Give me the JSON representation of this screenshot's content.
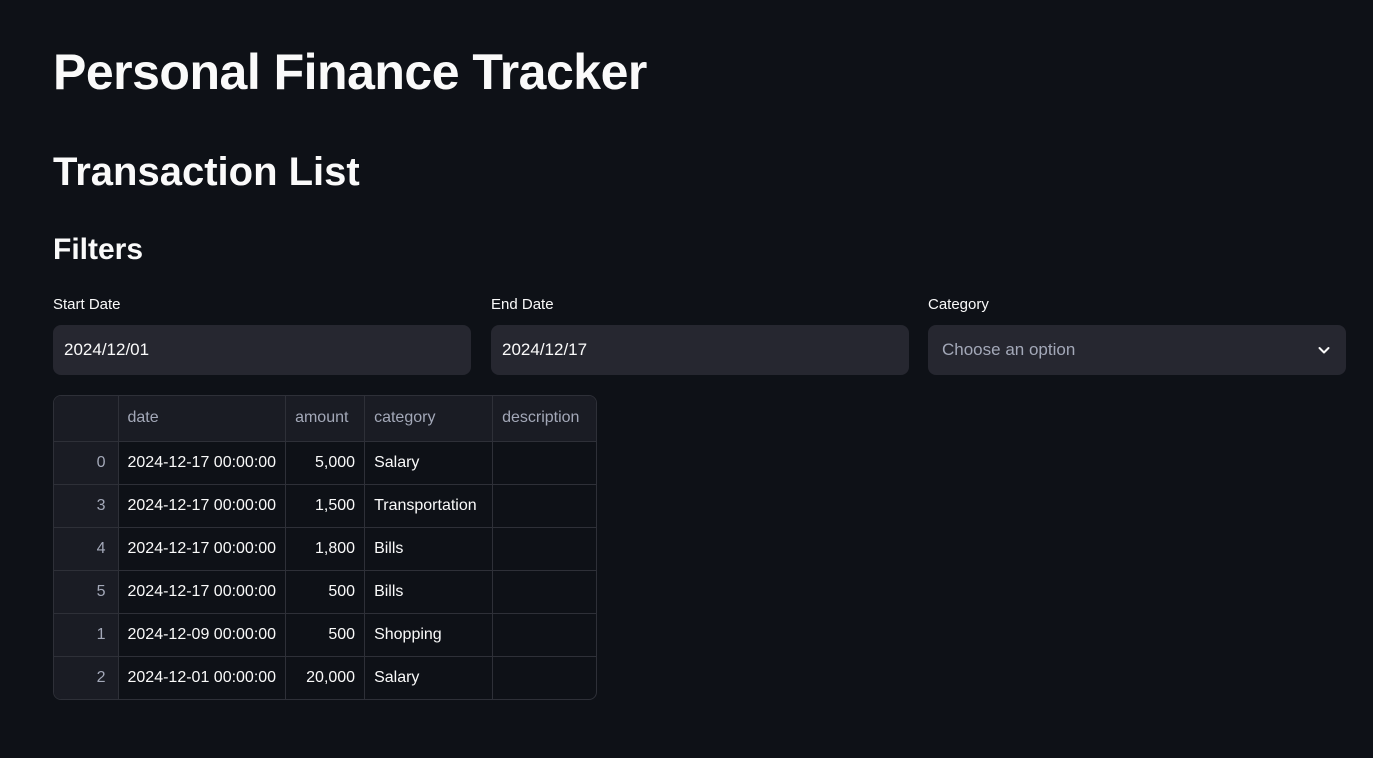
{
  "app": {
    "title": "Personal Finance Tracker"
  },
  "section": {
    "title": "Transaction List",
    "filters_title": "Filters"
  },
  "filters": {
    "start_date": {
      "label": "Start Date",
      "value": "2024/12/01"
    },
    "end_date": {
      "label": "End Date",
      "value": "2024/12/17"
    },
    "category": {
      "label": "Category",
      "placeholder": "Choose an option",
      "icon": "chevron-down-icon"
    }
  },
  "table": {
    "columns": [
      "",
      "date",
      "amount",
      "category",
      "description"
    ],
    "rows": [
      {
        "index": "0",
        "date": "2024-12-17 00:00:00",
        "amount": "5,000",
        "category": "Salary",
        "description": ""
      },
      {
        "index": "3",
        "date": "2024-12-17 00:00:00",
        "amount": "1,500",
        "category": "Transportation",
        "description": ""
      },
      {
        "index": "4",
        "date": "2024-12-17 00:00:00",
        "amount": "1,800",
        "category": "Bills",
        "description": ""
      },
      {
        "index": "5",
        "date": "2024-12-17 00:00:00",
        "amount": "500",
        "category": "Bills",
        "description": ""
      },
      {
        "index": "1",
        "date": "2024-12-09 00:00:00",
        "amount": "500",
        "category": "Shopping",
        "description": ""
      },
      {
        "index": "2",
        "date": "2024-12-01 00:00:00",
        "amount": "20,000",
        "category": "Salary",
        "description": ""
      }
    ]
  },
  "colors": {
    "background": "#0e1117",
    "input_background": "#262730",
    "text": "#fafafa",
    "muted_text": "#a3a8b8",
    "border": "#2e3038"
  }
}
